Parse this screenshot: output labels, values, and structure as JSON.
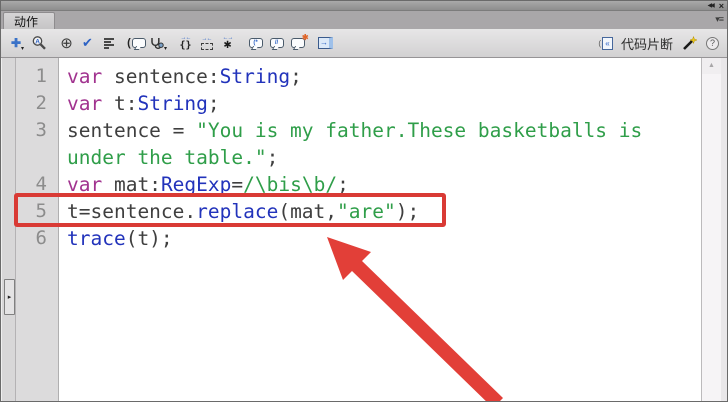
{
  "panel": {
    "title_tab": "动作",
    "window_controls": {
      "collapse_icon": "◀◀",
      "close_icon": "×"
    },
    "panel_menu_icon": "▾≡"
  },
  "toolbar": {
    "icons": {
      "add_script": {
        "glyph": "✚",
        "caret": "▾"
      },
      "insert_target": {
        "glyph": "⊕"
      },
      "check_syntax": {
        "glyph": "✔"
      },
      "show_code_hint": {
        "glyph": "("
      },
      "debug_options": {
        "caret": "▾"
      },
      "collapse_braces": {
        "arrows": "→←",
        "glyph": "{}"
      },
      "collapse_selection": {
        "arrows": "→←"
      },
      "expand_all": {
        "arrows": "←→",
        "glyph": "✱"
      },
      "block_comment": {
        "glyph": "(*"
      },
      "line_comment": {
        "glyph": "//"
      },
      "remove_comment": {
        "star": "✱"
      },
      "show_toolbox": {
        "glyph": "→"
      }
    },
    "snippets_button": {
      "doc_glyph": "«",
      "paren": "(",
      "label": "代码片断"
    },
    "help_icon": "?",
    "scroll_up_glyph": "▲",
    "splitter_glyph": "▸"
  },
  "editor": {
    "gutter": [
      "1",
      "2",
      "3",
      "",
      "4",
      "5",
      "6"
    ],
    "rows": [
      {
        "segments": [
          {
            "t": "var"
          },
          {
            "t": " sentence:"
          },
          {
            "t": "String"
          },
          {
            "t": ";"
          }
        ]
      },
      {
        "segments": [
          {
            "t": "var"
          },
          {
            "t": " t:"
          },
          {
            "t": "String"
          },
          {
            "t": ";"
          }
        ]
      },
      {
        "segments": [
          {
            "t": "sentence = "
          },
          {
            "t": "\"You is my father.These basketballs is"
          }
        ]
      },
      {
        "segments": [
          {
            "t": "under the table.\""
          },
          {
            "t": ";"
          }
        ]
      },
      {
        "segments": [
          {
            "t": "var"
          },
          {
            "t": " mat:"
          },
          {
            "t": "RegExp"
          },
          {
            "t": "="
          },
          {
            "t": "/\\bis\\b/"
          },
          {
            "t": ";"
          }
        ]
      },
      {
        "segments": [
          {
            "t": "t=sentence."
          },
          {
            "t": "replace"
          },
          {
            "t": "(mat,"
          },
          {
            "t": "\"are\""
          },
          {
            "t": ");"
          }
        ]
      },
      {
        "segments": [
          {
            "t": "trace"
          },
          {
            "t": "(t);"
          }
        ]
      }
    ]
  },
  "annotations": {
    "highlighted_line_number": "5",
    "highlighted_code": "t=sentence.replace(mat,\"are\");",
    "arrow_target": "line 5"
  },
  "colors": {
    "keyword": "#a1338f",
    "type_function": "#2233bb",
    "string": "#2f9e49",
    "plain": "#3f3f3f",
    "highlight_red": "#d93a35",
    "arrow_red": "#e23f38"
  }
}
